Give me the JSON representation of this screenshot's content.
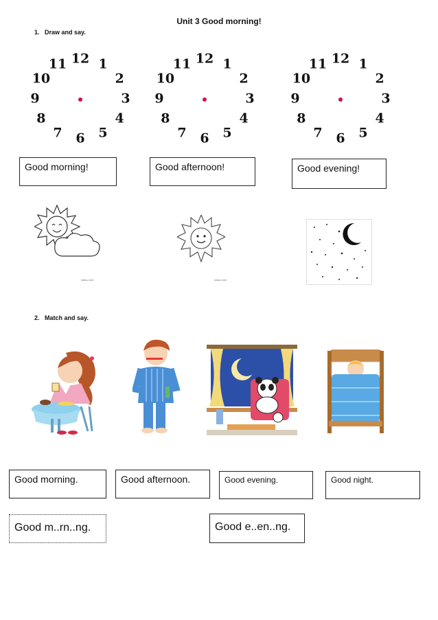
{
  "title": "Unit 3 Good morning!",
  "section1": {
    "number": "1.",
    "label": "Draw and say."
  },
  "section2": {
    "number": "2.",
    "label": "Match and say."
  },
  "clock_numbers": [
    "12",
    "1",
    "2",
    "3",
    "4",
    "5",
    "6",
    "7",
    "8",
    "9",
    "10",
    "11"
  ],
  "greetings_top": [
    "Good  morning!",
    "Good  afternoon!",
    "Good  evening!"
  ],
  "match_boxes": [
    "Good morning.",
    "Good afternoon.",
    "Good evening.",
    "Good night."
  ],
  "fill_boxes": [
    "Good m..rn..ng.",
    "Good e..en..ng."
  ],
  "icons": [
    "sun-behind-cloud-icon",
    "smiling-sun-icon",
    "moon-and-stars-icon",
    "girl-eating-breakfast-icon",
    "boy-brushing-teeth-icon",
    "panda-in-armchair-icon",
    "child-in-bed-icon"
  ],
  "colors": {
    "clock_dot": "#d0104a",
    "night_sky": "#ffffff"
  }
}
